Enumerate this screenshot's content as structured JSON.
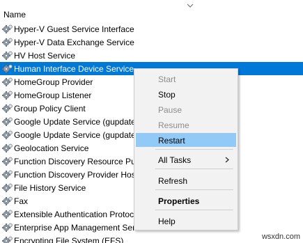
{
  "header": {
    "column_name": "Name"
  },
  "services": [
    {
      "label": "Hyper-V Guest Service Interface"
    },
    {
      "label": "Hyper-V Data Exchange Service"
    },
    {
      "label": "HV Host Service"
    },
    {
      "label": "Human Interface Device Service"
    },
    {
      "label": "HomeGroup Provider"
    },
    {
      "label": "HomeGroup Listener"
    },
    {
      "label": "Group Policy Client"
    },
    {
      "label": "Google Update Service (gupdate"
    },
    {
      "label": "Google Update Service (gupdate"
    },
    {
      "label": "Geolocation Service"
    },
    {
      "label": "Function Discovery Resource Pul"
    },
    {
      "label": "Function Discovery Provider Hos"
    },
    {
      "label": "File History Service"
    },
    {
      "label": "Fax"
    },
    {
      "label": "Extensible Authentication Protoc"
    },
    {
      "label": "Enterprise App Management Ser"
    },
    {
      "label": "Encrypting File System (EFS)"
    }
  ],
  "selected_index": 3,
  "context_menu": {
    "start": "Start",
    "stop": "Stop",
    "pause": "Pause",
    "resume": "Resume",
    "restart": "Restart",
    "all_tasks": "All Tasks",
    "refresh": "Refresh",
    "properties": "Properties",
    "help": "Help"
  },
  "watermark": "wsxdn.com",
  "colors": {
    "selection": "#0078d7",
    "menu_highlight": "#91c9f7",
    "menu_background": "#f2f2f2",
    "disabled_text": "#8c8c8c"
  },
  "icons": {
    "service": "gear-icon",
    "sort": "chevron-down-icon",
    "submenu": "chevron-right-icon"
  }
}
